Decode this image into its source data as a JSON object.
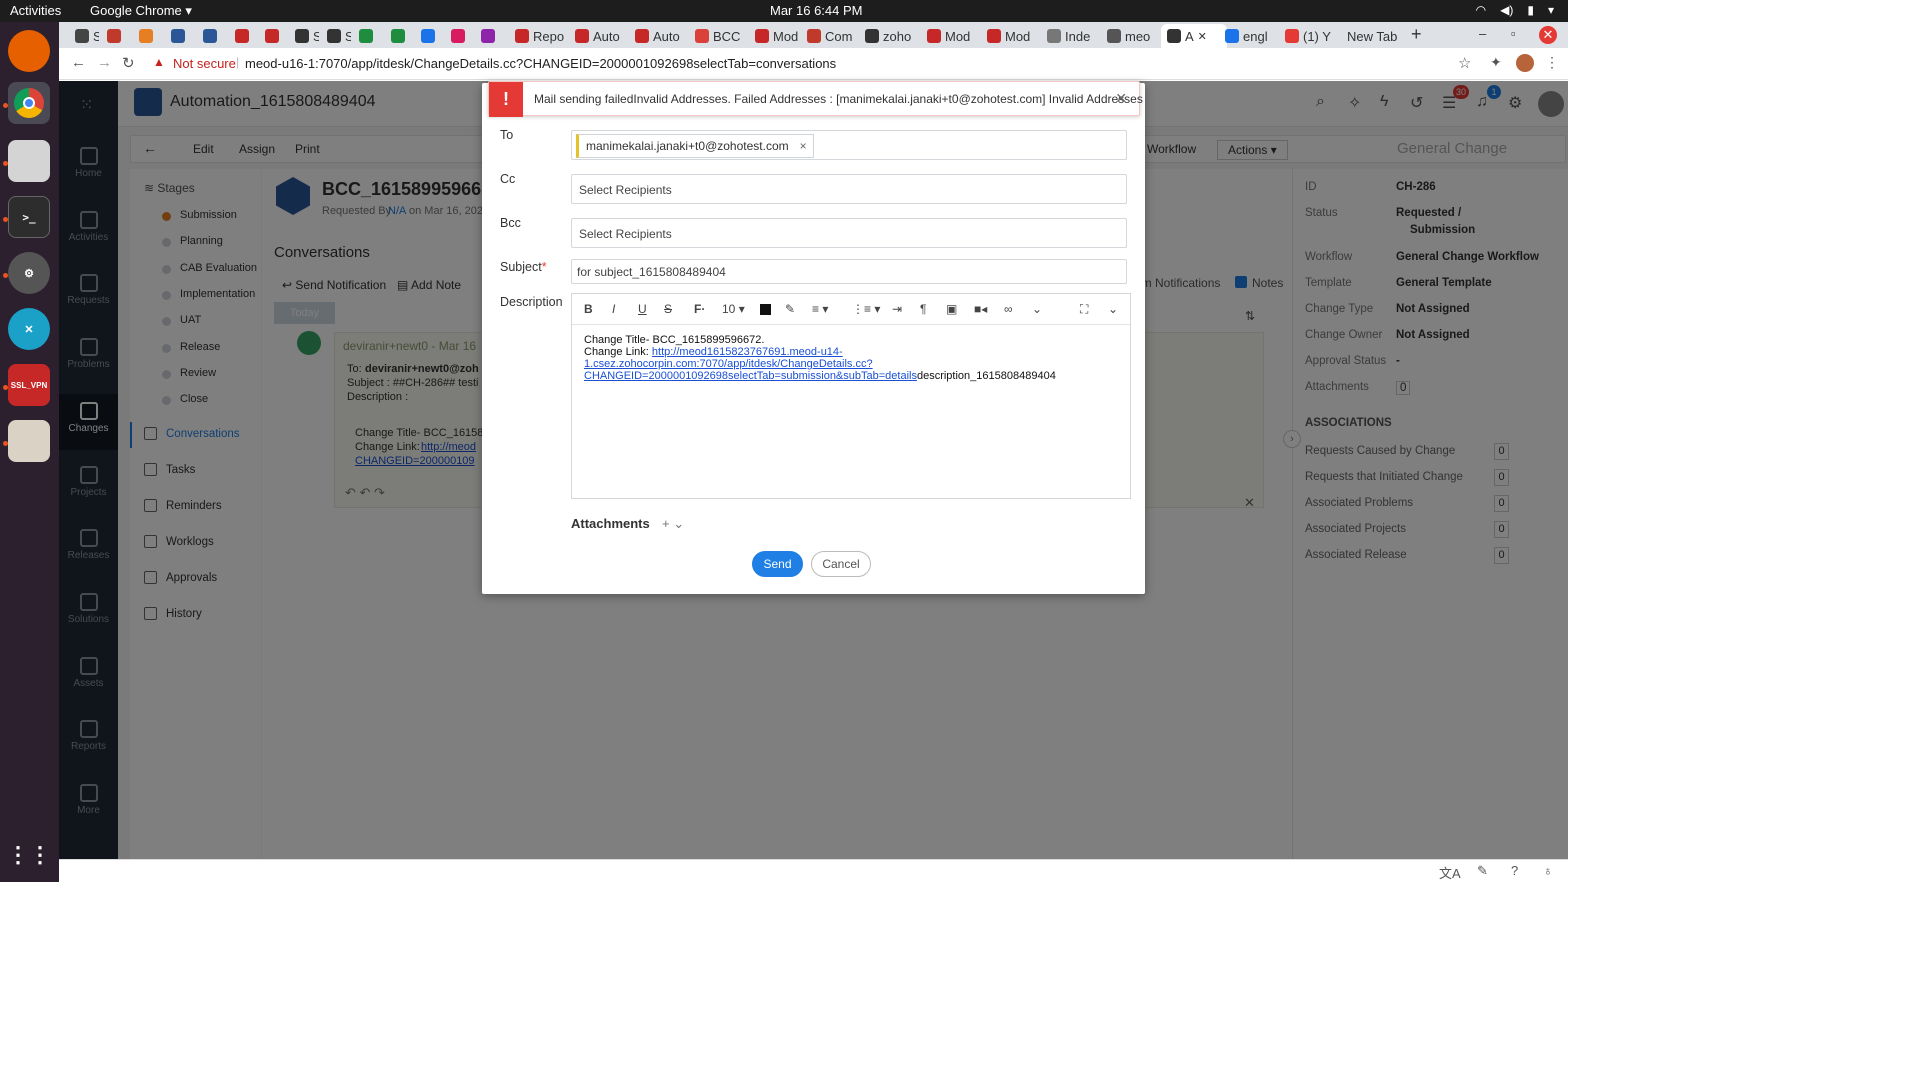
{
  "system": {
    "activities": "Activities",
    "app_name": "Google Chrome",
    "clock": "Mar 16  6:44 PM"
  },
  "tabs": [
    {
      "label": "SD"
    },
    {
      "label": ""
    },
    {
      "label": ""
    },
    {
      "label": ""
    },
    {
      "label": ""
    },
    {
      "label": ""
    },
    {
      "label": ""
    },
    {
      "label": "SD"
    },
    {
      "label": "SD"
    },
    {
      "label": ""
    },
    {
      "label": ""
    },
    {
      "label": ""
    },
    {
      "label": ""
    },
    {
      "label": ""
    },
    {
      "label": "Repo"
    },
    {
      "label": "Auto"
    },
    {
      "label": "Auto"
    },
    {
      "label": "BCC"
    },
    {
      "label": "Mod"
    },
    {
      "label": "Com"
    },
    {
      "label": "zoho"
    },
    {
      "label": "Mod"
    },
    {
      "label": "Mod"
    },
    {
      "label": "Inde"
    },
    {
      "label": "meo"
    },
    {
      "label": "A"
    },
    {
      "label": "engl"
    },
    {
      "label": "(1) Y"
    },
    {
      "label": "New Tab"
    }
  ],
  "browser": {
    "not_secure": "Not secure",
    "url": "meod-u16-1:7070/app/itdesk/ChangeDetails.cc?CHANGEID=2000001092698selectTab=conversations"
  },
  "app": {
    "title": "Automation_1615808489404",
    "nav": [
      "Home",
      "Activities",
      "Requests",
      "Problems",
      "Changes",
      "Projects",
      "Releases",
      "Solutions",
      "Assets",
      "Reports",
      "More"
    ],
    "toolbar": {
      "edit": "Edit",
      "assign": "Assign",
      "print": "Print",
      "workflow": "Workflow",
      "actions": "Actions",
      "template_title": "General Change"
    },
    "stages_title": "Stages",
    "stages": [
      "Submission",
      "Planning",
      "CAB Evaluation",
      "Implementation",
      "UAT",
      "Release",
      "Review",
      "Close"
    ],
    "menu": [
      "Conversations",
      "Tasks",
      "Reminders",
      "Worklogs",
      "Approvals",
      "History"
    ],
    "change_title": "BCC_16158995966",
    "requested_by": "Requested By",
    "requester": "N/A",
    "requested_on": "on Mar 16, 2021",
    "conversations_title": "Conversations",
    "send_notification": "Send Notification",
    "add_note": "Add Note",
    "today": "Today",
    "system_notifications": "em Notifications",
    "notes": "Notes",
    "conv": {
      "from": "deviranir+newt0 - Mar 16",
      "to_label": "To:",
      "to_value": "deviranir+newt0@zoh",
      "subject": "Subject : ##CH-286## testi",
      "description": "Description :",
      "change_title": "Change Title- BCC_16158",
      "change_link_label": "Change Link:",
      "change_link": "http://meod",
      "change_link_2": "CHANGEID=200000109"
    },
    "props": [
      {
        "label": "ID",
        "value": "CH-286"
      },
      {
        "label": "Status",
        "value": "Requested /"
      },
      {
        "label": "",
        "value": "Submission"
      },
      {
        "label": "Workflow",
        "value": "General Change Workflow"
      },
      {
        "label": "Template",
        "value": "General Template"
      },
      {
        "label": "Change Type",
        "value": "Not Assigned"
      },
      {
        "label": "Change Owner",
        "value": "Not Assigned"
      },
      {
        "label": "Approval Status",
        "value": "-"
      },
      {
        "label": "Attachments",
        "value": "0"
      }
    ],
    "associations_title": "ASSOCIATIONS",
    "associations": [
      {
        "label": "Requests Caused by Change",
        "count": "0"
      },
      {
        "label": "Requests that Initiated Change",
        "count": "0"
      },
      {
        "label": "Associated Problems",
        "count": "0"
      },
      {
        "label": "Associated Projects",
        "count": "0"
      },
      {
        "label": "Associated Release",
        "count": "0"
      }
    ],
    "header_badges": {
      "first": "30",
      "second": "1"
    }
  },
  "alert": {
    "message": "Mail sending failedInvalid Addresses. Failed Addresses : [manimekalai.janaki+t0@zohotest.com] Invalid Addresses"
  },
  "modal": {
    "to_label": "To",
    "to_chip": "manimekalai.janaki+t0@zohotest.com",
    "cc_label": "Cc",
    "cc_placeholder": "Select Recipients",
    "bcc_label": "Bcc",
    "bcc_placeholder": "Select Recipients",
    "subject_label": "Subject",
    "subject_value": "for subject_1615808489404",
    "description_label": "Description",
    "font_size": "10",
    "body_line1": "Change Title- BCC_1615899596672.",
    "body_link_label": "Change Link:",
    "body_link": "http://meod1615823767691.meod-u14-1.csez.zohocorpin.com:7070/app/itdesk/ChangeDetails.cc?",
    "body_link_2": "CHANGEID=2000001092698selectTab=submission&subTab=details",
    "body_tail": "description_1615808489404",
    "attachments_label": "Attachments",
    "send": "Send",
    "cancel": "Cancel"
  },
  "colors": {
    "accent": "#1f7fe5",
    "danger": "#e53935",
    "nav_bg": "#1f2a36"
  }
}
